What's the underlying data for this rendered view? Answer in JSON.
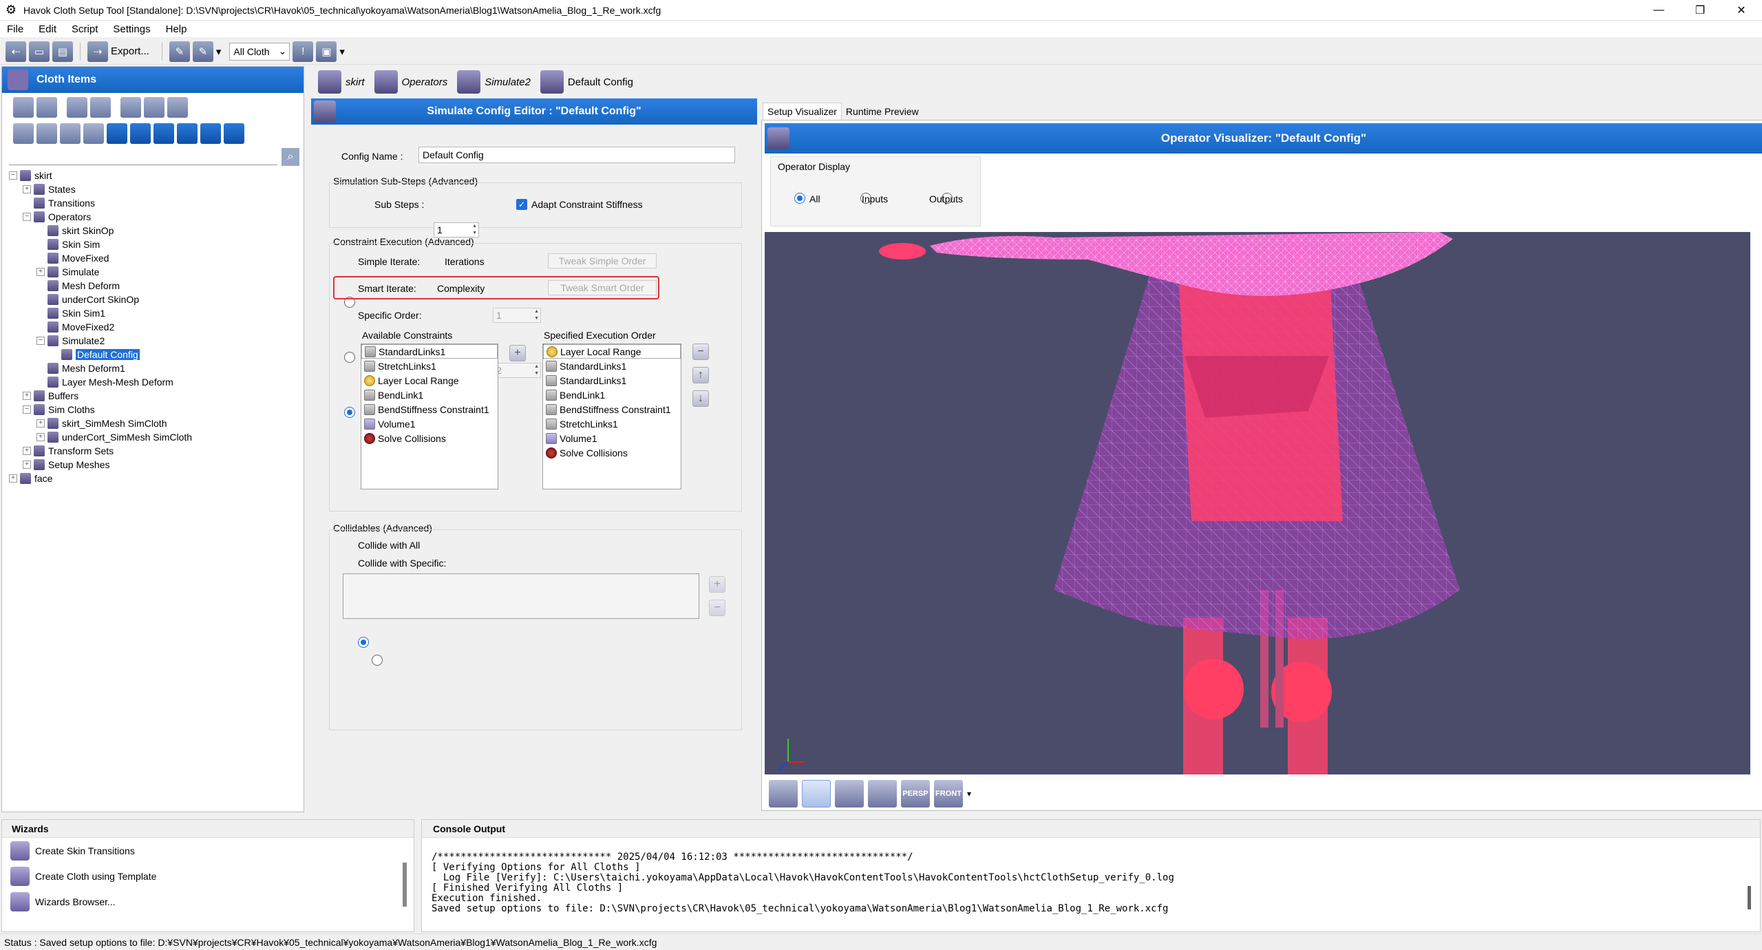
{
  "window": {
    "title": "Havok Cloth Setup Tool [Standalone]: D:\\SVN\\projects\\CR\\Havok\\05_technical\\yokoyama\\WatsonAmeria\\Blog1\\WatsonAmelia_Blog_1_Re_work.xcfg",
    "minimize": "—",
    "maximize": "❐",
    "close": "✕"
  },
  "menu": [
    "File",
    "Edit",
    "Script",
    "Settings",
    "Help"
  ],
  "toolbar": {
    "export_label": "Export...",
    "cloth_select": "All Cloth"
  },
  "cloth_items": {
    "title": "Cloth Items",
    "tree": [
      {
        "label": "skirt",
        "level": 0,
        "expander": "−"
      },
      {
        "label": "States",
        "level": 1,
        "expander": "+"
      },
      {
        "label": "Transitions",
        "level": 1,
        "expander": ""
      },
      {
        "label": "Operators",
        "level": 1,
        "expander": "−"
      },
      {
        "label": "skirt SkinOp",
        "level": 2,
        "expander": ""
      },
      {
        "label": "Skin Sim",
        "level": 2,
        "expander": ""
      },
      {
        "label": "MoveFixed",
        "level": 2,
        "expander": ""
      },
      {
        "label": "Simulate",
        "level": 2,
        "expander": "+"
      },
      {
        "label": "Mesh Deform",
        "level": 2,
        "expander": ""
      },
      {
        "label": "underCort SkinOp",
        "level": 2,
        "expander": ""
      },
      {
        "label": "Skin Sim1",
        "level": 2,
        "expander": ""
      },
      {
        "label": "MoveFixed2",
        "level": 2,
        "expander": ""
      },
      {
        "label": "Simulate2",
        "level": 2,
        "expander": "−"
      },
      {
        "label": "Default Config",
        "level": 3,
        "expander": "",
        "selected": true
      },
      {
        "label": "Mesh Deform1",
        "level": 2,
        "expander": ""
      },
      {
        "label": "Layer Mesh-Mesh Deform",
        "level": 2,
        "expander": ""
      },
      {
        "label": "Buffers",
        "level": 1,
        "expander": "+"
      },
      {
        "label": "Sim Cloths",
        "level": 1,
        "expander": "−"
      },
      {
        "label": "skirt_SimMesh SimCloth",
        "level": 2,
        "expander": "+"
      },
      {
        "label": "underCort_SimMesh SimCloth",
        "level": 2,
        "expander": "+"
      },
      {
        "label": "Transform Sets",
        "level": 1,
        "expander": "+"
      },
      {
        "label": "Setup Meshes",
        "level": 1,
        "expander": "+"
      },
      {
        "label": "face",
        "level": 0,
        "expander": "+"
      }
    ]
  },
  "op_tabs": [
    {
      "label": "skirt",
      "italic": true
    },
    {
      "label": "Operators",
      "italic": true
    },
    {
      "label": "Simulate2",
      "italic": true
    },
    {
      "label": "Default Config",
      "italic": false
    }
  ],
  "editor": {
    "title": "Simulate Config Editor : \"Default Config\"",
    "config_name_label": "Config Name :",
    "config_name_value": "Default Config",
    "substeps_group": "Simulation Sub-Steps (Advanced)",
    "substeps_label": "Sub Steps :",
    "substeps_value": "1",
    "adapt_label": "Adapt Constraint Stiffness",
    "constraint_group": "Constraint Execution (Advanced)",
    "simple_iterate": "Simple Iterate:",
    "iterations_label": "Iterations",
    "iterations_value": "1",
    "tweak_simple": "Tweak Simple Order",
    "smart_iterate": "Smart Iterate:",
    "complexity_label": "Complexity",
    "complexity_value": "2",
    "tweak_smart": "Tweak Smart Order",
    "specific_order": "Specific Order:",
    "available_label": "Available Constraints",
    "specified_label": "Specified Execution Order",
    "available": [
      {
        "label": "StandardLinks1",
        "icon": "links"
      },
      {
        "label": "StretchLinks1",
        "icon": "links"
      },
      {
        "label": "Layer Local Range",
        "icon": "gold"
      },
      {
        "label": "BendLink1",
        "icon": "links"
      },
      {
        "label": "BendStiffness Constraint1",
        "icon": "links"
      },
      {
        "label": "Volume1",
        "icon": "purple"
      },
      {
        "label": "Solve Collisions",
        "icon": "red"
      }
    ],
    "specified": [
      {
        "label": "Layer Local Range",
        "icon": "gold"
      },
      {
        "label": "StandardLinks1",
        "icon": "links"
      },
      {
        "label": "StandardLinks1",
        "icon": "links"
      },
      {
        "label": "BendLink1",
        "icon": "links"
      },
      {
        "label": "BendStiffness Constraint1",
        "icon": "links"
      },
      {
        "label": "StretchLinks1",
        "icon": "links"
      },
      {
        "label": "Volume1",
        "icon": "purple"
      },
      {
        "label": "Solve Collisions",
        "icon": "red"
      }
    ],
    "collidables_group": "Collidables (Advanced)",
    "collide_all": "Collide with All",
    "collide_specific": "Collide with Specific:"
  },
  "visualizer": {
    "tab_setup": "Setup Visualizer",
    "tab_runtime": "Runtime Preview",
    "title": "Operator Visualizer: \"Default Config\"",
    "display_group": "Operator Display",
    "opt_all": "All",
    "opt_inputs": "Inputs",
    "opt_outputs": "Outputs",
    "viewport_bg": "#4a4c6a",
    "tools": [
      "",
      "",
      "",
      "",
      "PERSP",
      "FRONT"
    ]
  },
  "wizards": {
    "title": "Wizards",
    "items": [
      "Create Skin Transitions",
      "Create Cloth using Template",
      "Wizards Browser..."
    ]
  },
  "console": {
    "title": "Console Output",
    "lines": [
      "/****************************** 2025/04/04 16:12:03 ******************************/",
      "[ Verifying Options for All Cloths ]",
      "  Log File [Verify]: C:\\Users\\taichi.yokoyama\\AppData\\Local\\Havok\\HavokContentTools\\HavokContentTools\\hctClothSetup_verify_0.log",
      "[ Finished Verifying All Cloths ]",
      "Execution finished.",
      "Saved setup options to file: D:\\SVN\\projects\\CR\\Havok\\05_technical\\yokoyama\\WatsonAmeria\\Blog1\\WatsonAmelia_Blog_1_Re_work.xcfg"
    ]
  },
  "status": "Status : Saved setup options to file: D:¥SVN¥projects¥CR¥Havok¥05_technical¥yokoyama¥WatsonAmeria¥Blog1¥WatsonAmelia_Blog_1_Re_work.xcfg",
  "colors": {
    "header_blue": "#1f6fd8",
    "highlight_red": "#e0303a"
  }
}
